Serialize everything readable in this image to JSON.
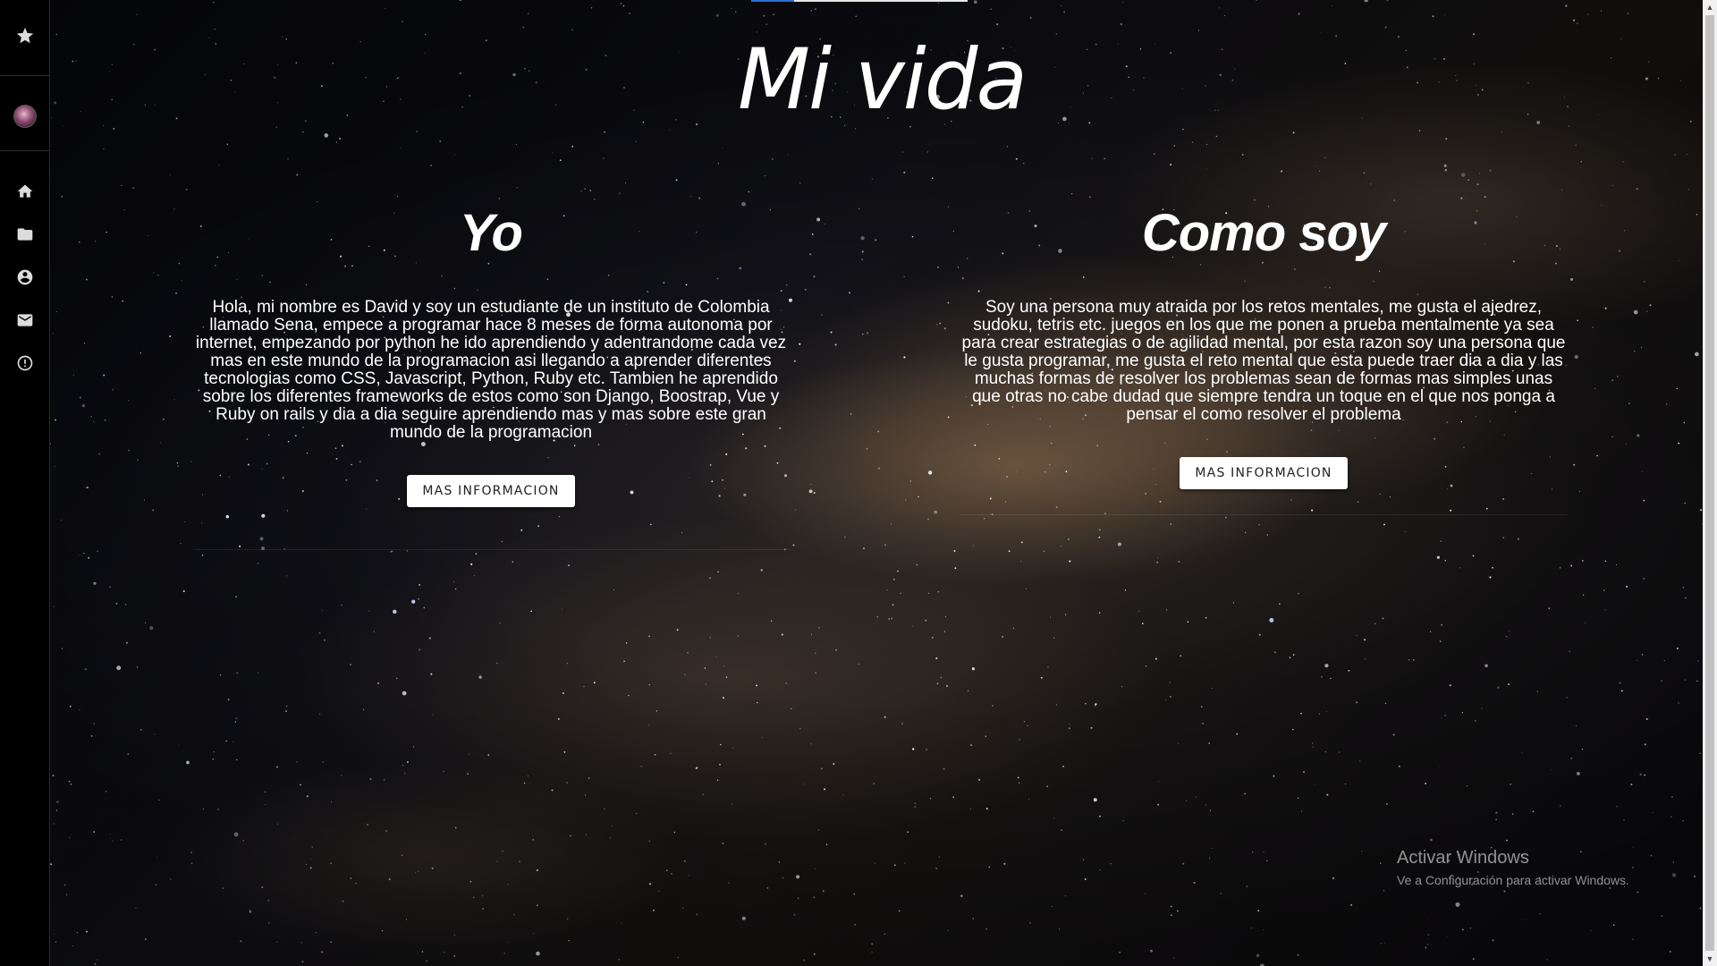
{
  "page": {
    "title": "Mi vida"
  },
  "sidebar": {
    "items": [
      {
        "icon": "star-icon"
      },
      {
        "icon": "avatar"
      },
      {
        "icon": "home-icon"
      },
      {
        "icon": "folder-icon"
      },
      {
        "icon": "account-circle-icon"
      },
      {
        "icon": "mail-icon"
      },
      {
        "icon": "alert-circle-icon"
      }
    ]
  },
  "sections": [
    {
      "heading": "Yo",
      "text": "Hola, mi nombre es David y soy un estudiante de un instituto de Colombia llamado Sena, empece a programar hace 8 meses de forma autonoma por internet, empezando por python he ido aprendiendo y adentrandome cada vez mas en este mundo de la programacion asi llegando a aprender diferentes tecnologias como CSS, Javascript, Python, Ruby etc. Tambien he aprendido sobre los diferentes frameworks de estos como son Django, Boostrap, Vue y Ruby on rails y dia a dia seguire aprendiendo mas y mas sobre este gran mundo de la programacion",
      "button": "MAS INFORMACION"
    },
    {
      "heading": "Como soy",
      "text": "Soy una persona muy atraida por los retos mentales, me gusta el ajedrez, sudoku, tetris etc. juegos en los que me ponen a prueba mentalmente ya sea para crear estrategias o de agilidad mental, por esta razon soy una persona que le gusta programar, me gusta el reto mental que esta puede traer dia a dia y las muchas formas de resolver los problemas sean de formas mas simples unas que otras no cabe dudad que siempre tendra un toque en el que nos ponga a pensar el como resolver el problema",
      "button": "MAS INFORMACION"
    }
  ],
  "watermark": {
    "title": "Activar Windows",
    "subtitle": "Ve a Configuración para activar Windows."
  },
  "colors": {
    "sidebar_bg": "#000000",
    "text": "#ffffff",
    "button_bg": "#ffffff",
    "button_text": "#222222",
    "progress_accent": "#2f6fd6"
  }
}
